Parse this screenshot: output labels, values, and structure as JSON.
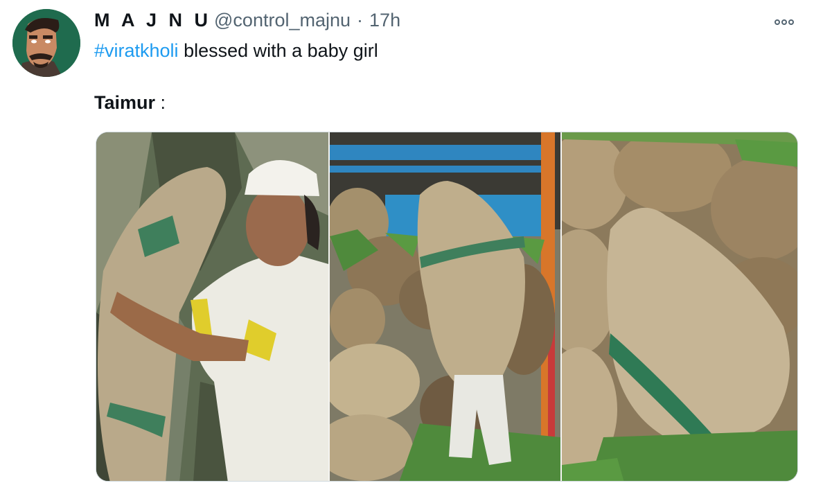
{
  "user": {
    "display_name": "M A J N U",
    "handle": "@control_majnu",
    "separator": "·",
    "time": "17h"
  },
  "tweet": {
    "hashtag": "#viratkholi",
    "text": " blessed with a baby girl",
    "caption_bold": "Taimur",
    "caption_rest": " :"
  },
  "icons": {
    "more": "more-options-icon",
    "avatar": "cartoon-man-avatar"
  },
  "colors": {
    "hashtag": "#1d9bf0",
    "secondary_text": "#536471",
    "avatar_bg": "#1f6b4e"
  }
}
